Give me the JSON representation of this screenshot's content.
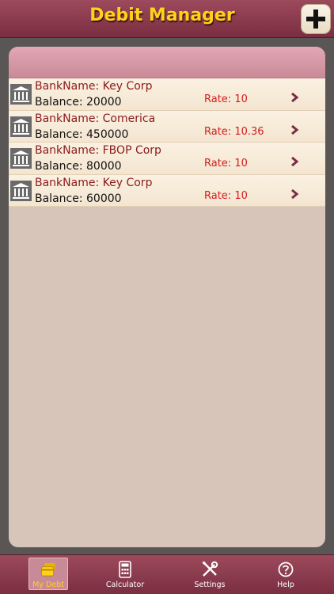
{
  "header": {
    "title": "Debit Manager",
    "add_icon": "plus-icon"
  },
  "debts": [
    {
      "bank_label": "BankName: Key Corp",
      "balance_label": "Balance: 20000",
      "rate_label": "Rate: 10"
    },
    {
      "bank_label": "BankName: Comerica",
      "balance_label": "Balance: 450000",
      "rate_label": "Rate: 10.36"
    },
    {
      "bank_label": "BankName: FBOP Corp",
      "balance_label": "Balance: 80000",
      "rate_label": "Rate: 10"
    },
    {
      "bank_label": "BankName: Key Corp",
      "balance_label": "Balance: 60000",
      "rate_label": "Rate: 10"
    }
  ],
  "tabs": [
    {
      "label": "My Debt",
      "icon": "debt-card-icon",
      "active": true
    },
    {
      "label": "Calculator",
      "icon": "calculator-icon",
      "active": false
    },
    {
      "label": "Settings",
      "icon": "tools-icon",
      "active": false
    },
    {
      "label": "Help",
      "icon": "help-icon",
      "active": false
    }
  ],
  "colors": {
    "bar": "#8a3a4e",
    "title": "#ffd21a",
    "bank_name": "#8b1a1a",
    "rate": "#d02020",
    "panel": "#d6c5b8"
  }
}
